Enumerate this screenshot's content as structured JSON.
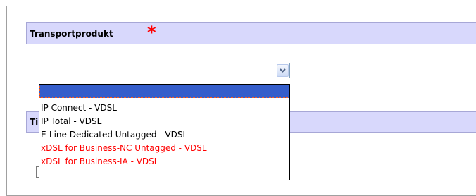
{
  "form": {
    "section_title": "Transportprodukt",
    "required_marker": "*",
    "second_section_title": "Ti"
  },
  "transport_select": {
    "selected_value": "",
    "options": [
      {
        "label": "",
        "selected": true,
        "color": "#000000"
      },
      {
        "label": "IP Connect - VDSL",
        "selected": false,
        "color": "#000000"
      },
      {
        "label": "IP Total - VDSL",
        "selected": false,
        "color": "#000000"
      },
      {
        "label": "E-Line Dedicated Untagged - VDSL",
        "selected": false,
        "color": "#000000"
      },
      {
        "label": "xDSL for Business-NC Untagged - VDSL",
        "selected": false,
        "color": "#ff0000"
      },
      {
        "label": "xDSL for Business-IA - VDSL",
        "selected": false,
        "color": "#ff0000"
      }
    ],
    "arrow_icon": "chevron-down-icon"
  },
  "colors": {
    "header_bg": "#d8d8fc",
    "selection_bg": "#355ecb",
    "required_star": "#ff0000",
    "restricted_option": "#ff0000"
  }
}
